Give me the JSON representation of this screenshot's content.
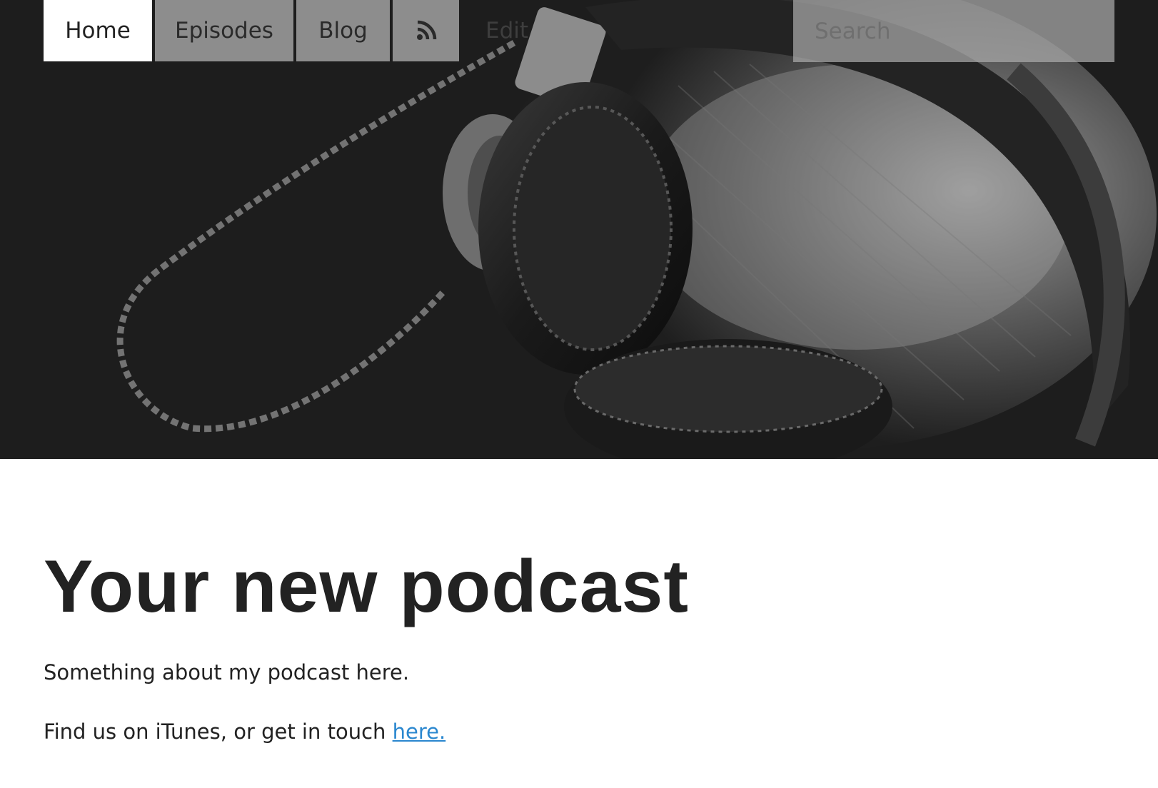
{
  "nav": {
    "tabs": [
      {
        "label": "Home",
        "active": true
      },
      {
        "label": "Episodes",
        "active": false
      },
      {
        "label": "Blog",
        "active": false
      }
    ],
    "rss_icon": "rss-icon",
    "edit_label": "Edit"
  },
  "search": {
    "placeholder": "Search",
    "value": ""
  },
  "hero": {
    "image": "headphones-photo"
  },
  "main": {
    "title": "Your new podcast",
    "paragraph1": "Something about my podcast here.",
    "paragraph2_text": "Find us on iTunes, or get in touch ",
    "paragraph2_link": "here."
  },
  "colors": {
    "link": "#2a87cf",
    "title": "#222222",
    "nav_tab_bg": "#b9b9b9",
    "active_tab_bg": "#ffffff"
  }
}
